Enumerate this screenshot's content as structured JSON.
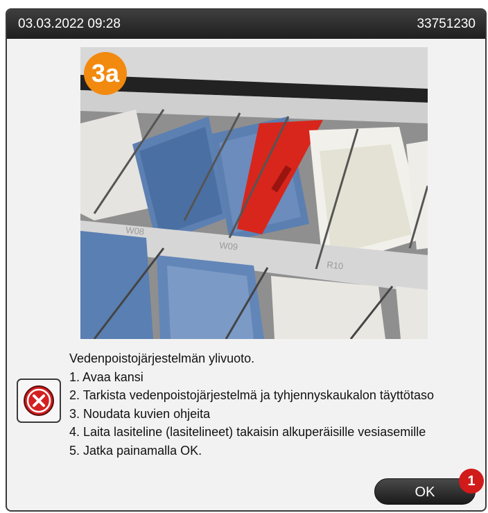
{
  "header": {
    "datetime": "03.03.2022 09:28",
    "device_id": "33751230"
  },
  "image": {
    "step_label": "3a",
    "station_labels": [
      "W08",
      "W09",
      "R10"
    ]
  },
  "message": {
    "title": "Vedenpoistojärjestelmän ylivuoto.",
    "steps": [
      "1. Avaa kansi",
      "2. Tarkista vedenpoistojärjestelmä ja tyhjennyskaukalon täyttötaso",
      "3. Noudata kuvien ohjeita",
      "4. Laita lasiteline (lasitelineet) takaisin alkuperäisille vesiasemille",
      "5. Jatka painamalla OK."
    ]
  },
  "error_icon": "error-x-icon",
  "buttons": {
    "ok_label": "OK"
  },
  "callout": "1",
  "colors": {
    "title_bar": "#2a2a2a",
    "step_badge": "#f28a10",
    "error_red": "#d42020",
    "callout_red": "#d11a1a",
    "rack_red": "#d8261c",
    "container_blue": "#5a7fb2"
  }
}
